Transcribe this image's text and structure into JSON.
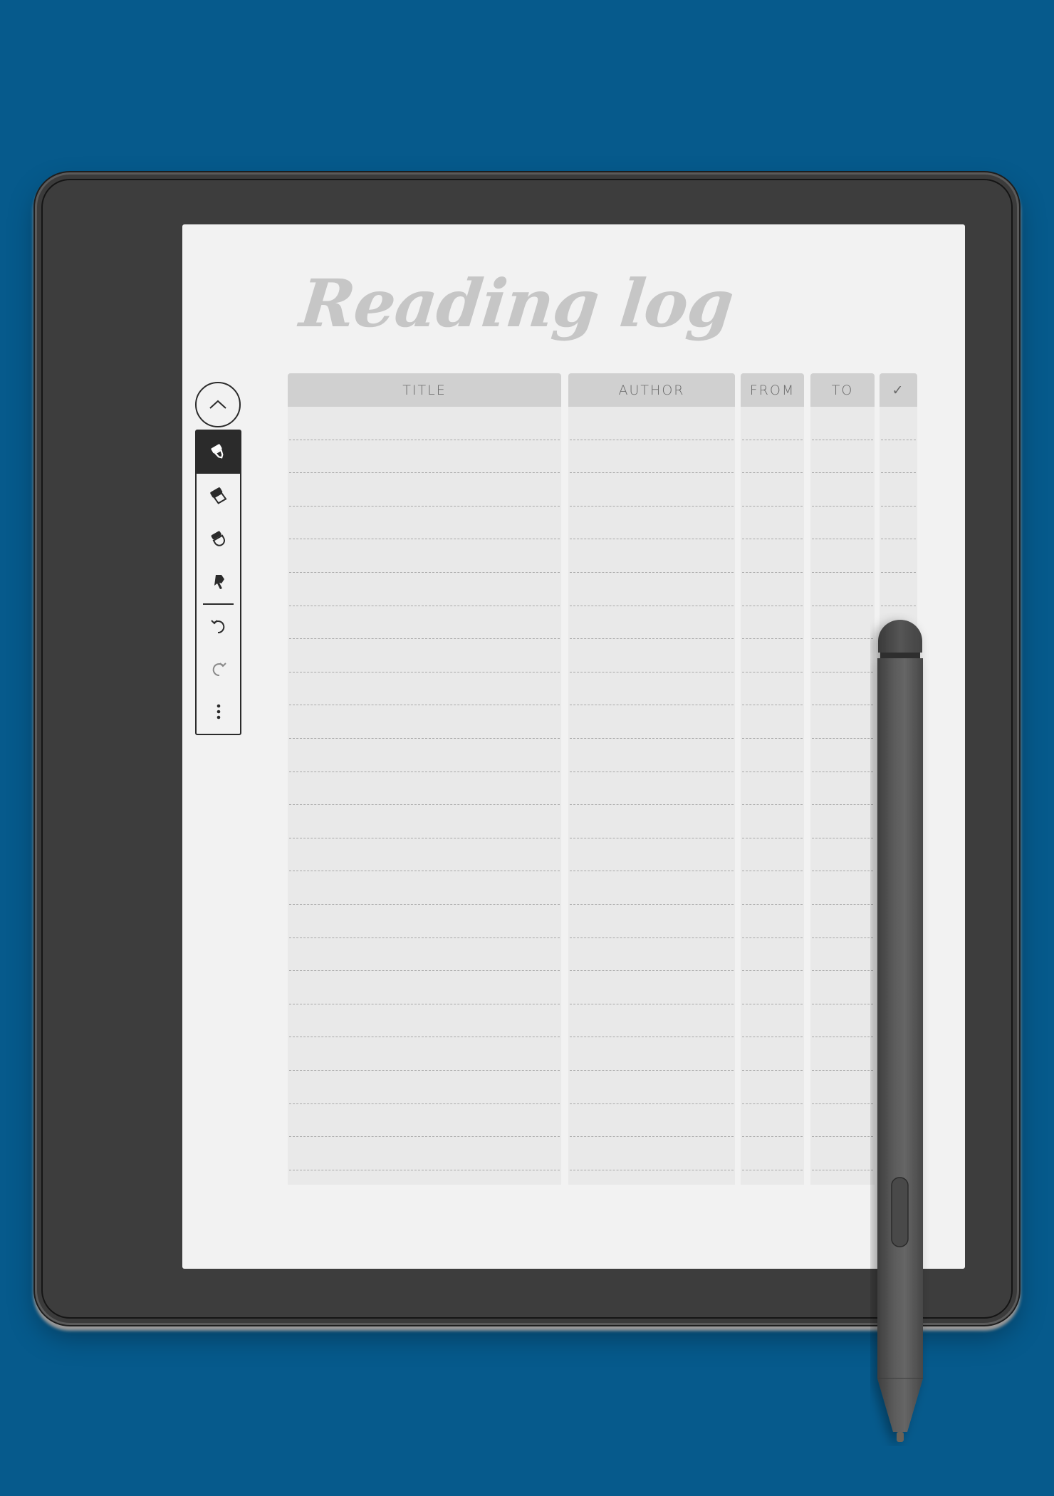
{
  "background_color": "#065a8c",
  "device": {
    "type": "e-reader with stylus",
    "screen_color": "#f2f2f2",
    "bezel_color": "#3b3b3b"
  },
  "page": {
    "title": "Reading log",
    "title_color": "#c6c6c6",
    "table": {
      "columns": [
        {
          "key": "title",
          "label": "TITLE"
        },
        {
          "key": "author",
          "label": "AUTHOR"
        },
        {
          "key": "from",
          "label": "FROM"
        },
        {
          "key": "to",
          "label": "TO"
        },
        {
          "key": "done",
          "label": "✓"
        }
      ],
      "row_count": 23,
      "rows": []
    }
  },
  "toolbar": {
    "collapse_button": {
      "icon": "chevron-up-icon",
      "label": "Collapse toolbar"
    },
    "tools": [
      {
        "name": "pen",
        "icon": "fountain-pen-icon",
        "active": true
      },
      {
        "name": "highlighter",
        "icon": "highlighter-icon",
        "active": false
      },
      {
        "name": "eraser",
        "icon": "eraser-icon",
        "active": false
      },
      {
        "name": "lasso-select",
        "icon": "lasso-select-icon",
        "active": false
      }
    ],
    "actions": [
      {
        "name": "undo",
        "icon": "undo-icon",
        "enabled": true
      },
      {
        "name": "redo",
        "icon": "redo-icon",
        "enabled": false
      },
      {
        "name": "more",
        "icon": "more-vertical-icon",
        "enabled": true
      }
    ]
  }
}
